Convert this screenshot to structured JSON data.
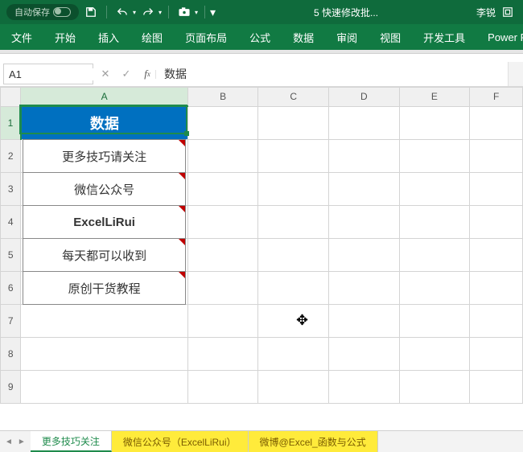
{
  "titlebar": {
    "autosave": "自动保存",
    "doc_title": "5 快速修改批...",
    "user": "李锐"
  },
  "ribbon": {
    "tabs": [
      "文件",
      "开始",
      "插入",
      "绘图",
      "页面布局",
      "公式",
      "数据",
      "审阅",
      "视图",
      "开发工具",
      "Power P"
    ]
  },
  "fx": {
    "namebox": "A1",
    "formula": "数据"
  },
  "columns": [
    "A",
    "B",
    "C",
    "D",
    "E",
    "F"
  ],
  "rows": [
    "1",
    "2",
    "3",
    "4",
    "5",
    "6",
    "7",
    "8",
    "9"
  ],
  "cells": {
    "A1": "数据",
    "A2": "更多技巧请关注",
    "A3": "微信公众号",
    "A4": "ExcelLiRui",
    "A5": "每天都可以收到",
    "A6": "原创干货教程"
  },
  "sheet_tabs": {
    "t1": "更多技巧关注",
    "t2": "微信公众号（ExcelLiRui）",
    "t3": "微博@Excel_函数与公式"
  }
}
